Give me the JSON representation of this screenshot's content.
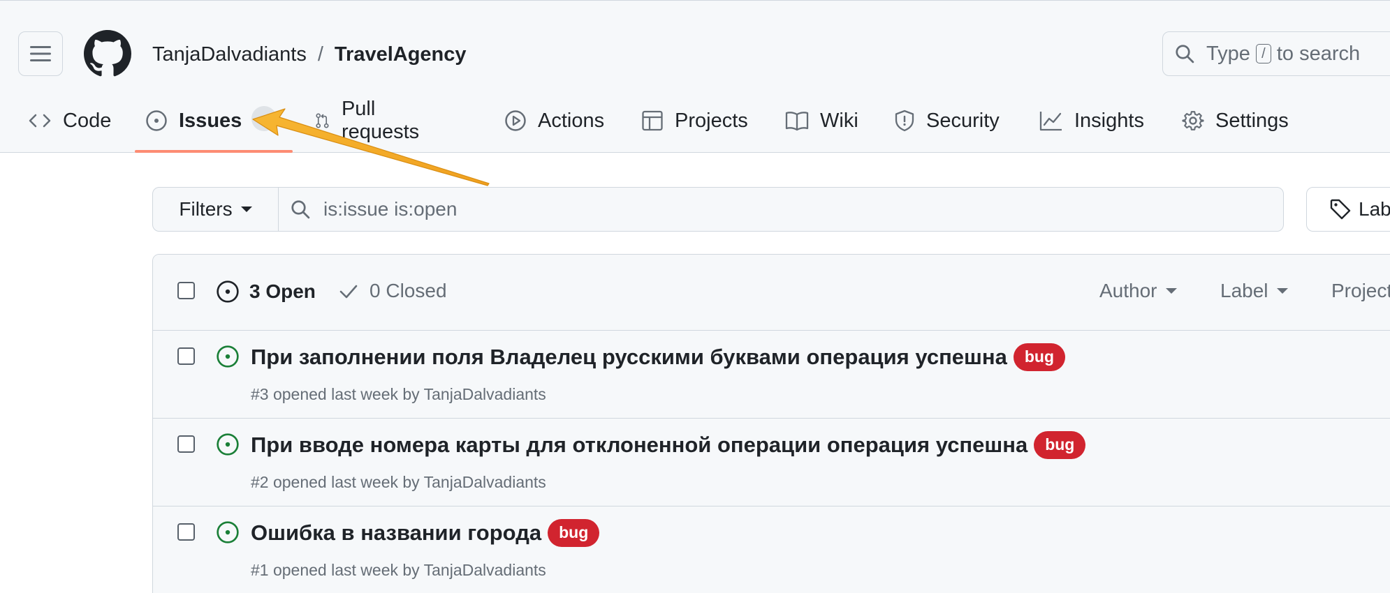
{
  "header": {
    "owner": "TanjaDalvadiants",
    "separator": "/",
    "repo": "TravelAgency",
    "search": {
      "prefix": "Type",
      "key": "/",
      "suffix": "to search"
    }
  },
  "tabs": [
    {
      "label": "Code",
      "icon": "code-icon"
    },
    {
      "label": "Issues",
      "icon": "issue-opened-icon",
      "selected": true
    },
    {
      "label": "Pull requests",
      "icon": "git-pull-request-icon"
    },
    {
      "label": "Actions",
      "icon": "play-icon"
    },
    {
      "label": "Projects",
      "icon": "table-icon"
    },
    {
      "label": "Wiki",
      "icon": "book-icon"
    },
    {
      "label": "Security",
      "icon": "shield-icon"
    },
    {
      "label": "Insights",
      "icon": "graph-icon"
    },
    {
      "label": "Settings",
      "icon": "gear-icon"
    }
  ],
  "filters": {
    "button_label": "Filters",
    "query": "is:issue is:open",
    "labels_button": "Lab"
  },
  "issues_header": {
    "open_count": "3 Open",
    "closed_count": "0 Closed",
    "author": "Author",
    "label": "Label",
    "projects": "Project"
  },
  "issues": [
    {
      "title": "При заполнении поля Владелец русскими буквами операция успешна",
      "label": "bug",
      "meta": "#3 opened last week by TanjaDalvadiants"
    },
    {
      "title": "При вводе номера карты для отклоненной операции операция успешна",
      "label": "bug",
      "meta": "#2 opened last week by TanjaDalvadiants"
    },
    {
      "title": "Ошибка в названии города",
      "label": "bug",
      "meta": "#1 opened last week by TanjaDalvadiants"
    }
  ],
  "colors": {
    "accent_underline": "#fd8c73",
    "open_green": "#1a7f37",
    "bug_label": "#d1242f",
    "annotation_arrow": "#f5a623"
  }
}
